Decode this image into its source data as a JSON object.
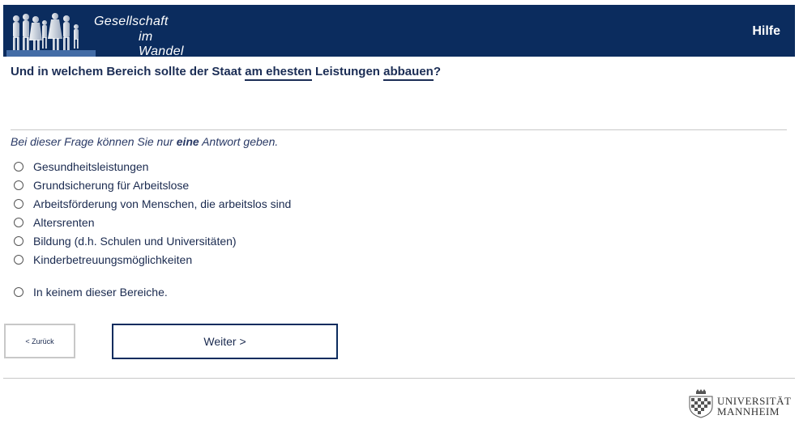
{
  "header": {
    "brand_line1": "Gesellschaft",
    "brand_line2": "im Wandel",
    "help_label": "Hilfe",
    "background_color": "#0b2c5e"
  },
  "question": {
    "part1": "Und in welchem Bereich sollte der Staat ",
    "underline1": "am ehesten",
    "part2": " Leistungen ",
    "underline2": "abbauen",
    "part3": "?"
  },
  "instruction": {
    "part1": "Bei dieser Frage können Sie nur ",
    "emphasis": "eine",
    "part2": " Antwort geben."
  },
  "options": [
    "Gesundheitsleistungen",
    "Grundsicherung für Arbeitslose",
    "Arbeitsförderung von Menschen, die arbeitslos sind",
    "Altersrenten",
    "Bildung (d.h. Schulen und Universitäten)",
    "Kinderbetreuungsmöglichkeiten",
    "In keinem dieser Bereiche."
  ],
  "nav": {
    "back_label": "< Zurück",
    "next_label": "Weiter >"
  },
  "footer": {
    "uni_line1": "UNIVERSITÄT",
    "uni_line2": "MANNHEIM"
  }
}
